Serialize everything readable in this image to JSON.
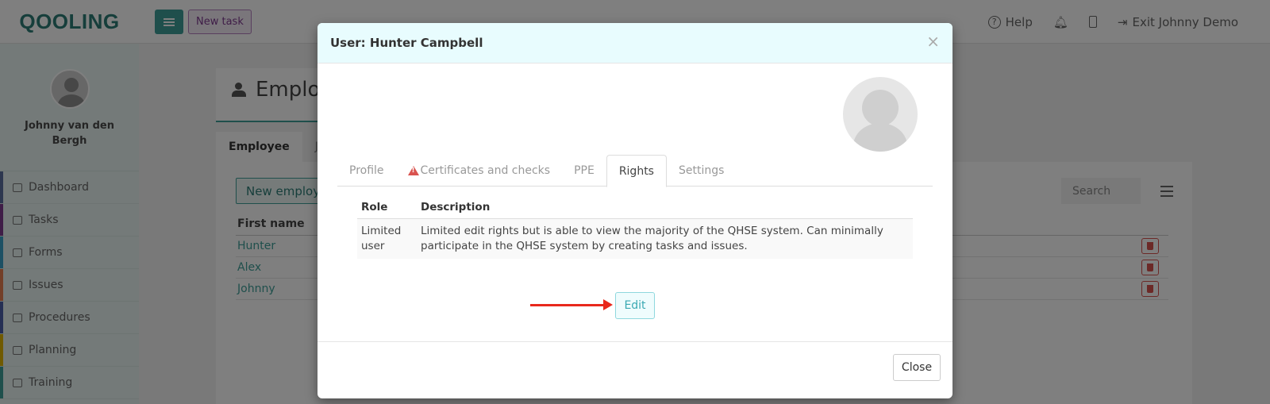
{
  "app": {
    "logo": "QOOLING",
    "new_task_label": "New task",
    "nav": {
      "help": "Help",
      "exit": "Exit Johnny Demo"
    }
  },
  "sidebar": {
    "user_name": "Johnny van den Bergh",
    "items": [
      {
        "label": "Dashboard",
        "color": "#5b6f9e"
      },
      {
        "label": "Tasks",
        "color": "#7e3a8f"
      },
      {
        "label": "Forms",
        "color": "#3aa0c8"
      },
      {
        "label": "Issues",
        "color": "#e67e50"
      },
      {
        "label": "Procedures",
        "color": "#4a5ea8"
      },
      {
        "label": "Planning",
        "color": "#e0b400"
      },
      {
        "label": "Training",
        "color": "#3e9e98"
      }
    ]
  },
  "page": {
    "title": "Employ",
    "tabs": [
      "Employee",
      "Job"
    ],
    "new_employee_label": "New employe",
    "search_placeholder": "Search",
    "table_header_first_name": "First name",
    "rows": [
      "Hunter",
      "Alex",
      "Johnny"
    ]
  },
  "modal": {
    "title": "User: Hunter Campbell",
    "close_x": "×",
    "tabs": [
      {
        "label": "Profile"
      },
      {
        "label": "Certificates and checks",
        "warning": true
      },
      {
        "label": "PPE"
      },
      {
        "label": "Rights",
        "active": true
      },
      {
        "label": "Settings"
      }
    ],
    "table": {
      "headers": {
        "role": "Role",
        "description": "Description"
      },
      "rows": [
        {
          "role": "Limited user",
          "description": "Limited edit rights but is able to view the majority of the QHSE system. Can minimally participate in the QHSE system by creating tasks and issues."
        }
      ]
    },
    "edit_label": "Edit",
    "close_label": "Close"
  },
  "colors": {
    "accent": "#3e9e98",
    "modal_header_bg": "#e8fcfe",
    "annotation_arrow": "#e8281c"
  }
}
